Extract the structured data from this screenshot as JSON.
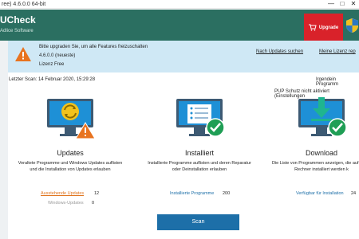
{
  "window": {
    "title": "ree) 4.6.0.0 64-bit",
    "minimize": "—",
    "close": "✕"
  },
  "header": {
    "app_title": "UCheck",
    "app_sub": "Adlice Software",
    "upgrade_label": "Upgrade"
  },
  "banner": {
    "line1": "Bitte upgraden Sie, um alle Features freizuschalten",
    "line2": "4.6.0.0 (neueste)",
    "line3": "Lizenz Free",
    "link_updates": "Nach Updates suchen",
    "link_license": "Meine Lizenz rep"
  },
  "info": {
    "last_scan": "Letzter Scan: 14 Februar 2020, 15:29:28",
    "program_status": "Irgendein Programm",
    "pup_status": "PUP Schutz nicht aktiviert (Einstellungen"
  },
  "columns": [
    {
      "title": "Updates",
      "desc": "Veraltete Programme und Windows Updates auflisten und die Installation von Updates erlauben",
      "stats": [
        {
          "label": "Ausstehende Updates",
          "value": "12"
        },
        {
          "label": "Windows-Updates",
          "value": "0"
        }
      ]
    },
    {
      "title": "Installiert",
      "desc": "Installierte Programme auflisten und deren Reparatur oder Deinstallation erlauben",
      "stats": [
        {
          "label": "Installierte Programme",
          "value": "200"
        }
      ]
    },
    {
      "title": "Download",
      "desc": "Die Liste von Programmen anzeigen, die auf Ihrem Rechner installiert werden k",
      "stats": [
        {
          "label": "Verfügbar für Installation",
          "value": "24"
        }
      ]
    }
  ],
  "scan_label": "Scan",
  "colors": {
    "header": "#2b6f61",
    "upgrade": "#d9222a",
    "banner": "#cfe8f5",
    "accent_blue": "#1d6fa8",
    "pending_orange": "#e0741d",
    "check_green": "#1f9e55"
  }
}
